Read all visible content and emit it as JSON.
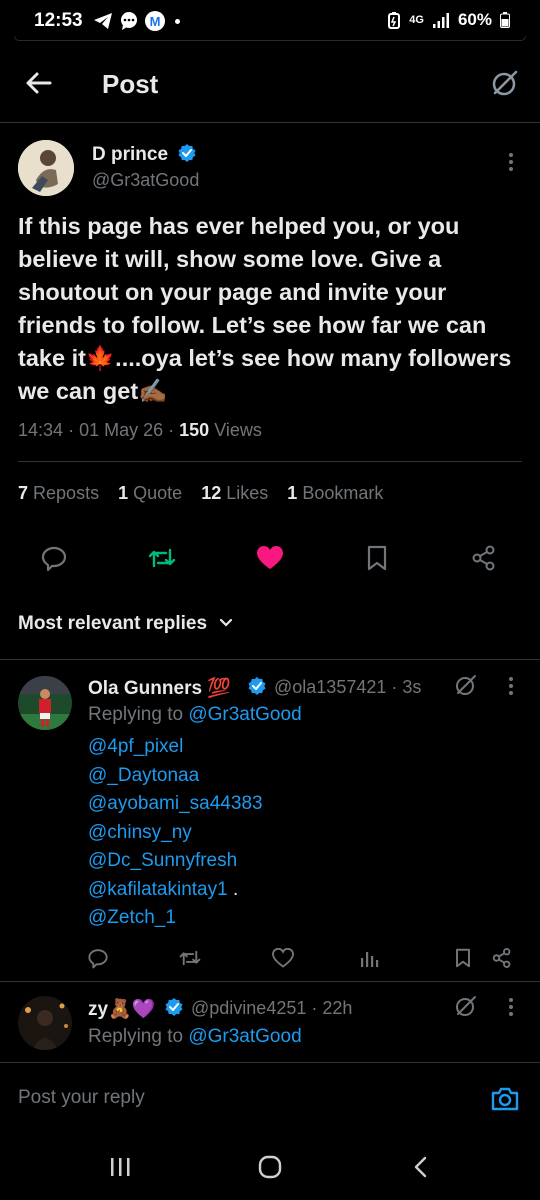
{
  "status_bar": {
    "time": "12:53",
    "left_badge": "M",
    "network": "4G",
    "battery": "60%"
  },
  "header": {
    "title": "Post"
  },
  "post": {
    "author_name": "D prince",
    "author_handle": "@Gr3atGood",
    "text": "If this page has ever helped you, or you believe it will, show some love. Give a shoutout on your page and invite your friends to follow. Let’s see how far we can take it🍁....oya let’s see how many followers we can get✍🏾",
    "time": "14:34",
    "date": "01 May 26",
    "views_count": "150",
    "views_label": "Views",
    "stats": [
      {
        "num": "7",
        "label": "Reposts"
      },
      {
        "num": "1",
        "label": "Quote"
      },
      {
        "num": "12",
        "label": "Likes"
      },
      {
        "num": "1",
        "label": "Bookmark"
      }
    ],
    "colors": {
      "accent": "#1d9bf0",
      "like": "#f91880",
      "repost": "#00ba7c"
    }
  },
  "replies_filter": "Most relevant replies",
  "replies": [
    {
      "name": "Ola Gunners 💯",
      "handle": "@ola1357421",
      "time": "· 3s",
      "replying_prefix": "Replying to ",
      "replying_to": "@Gr3atGood",
      "mentions": [
        "@4pf_pixel",
        "@_Daytonaa",
        "@ayobami_sa44383",
        "@chinsy_ny",
        "@Dc_Sunnyfresh",
        "@kafilatakintay1",
        "@Zetch_1"
      ],
      "mention_suffix": " ."
    },
    {
      "name": "zy🧸💜",
      "handle": "@pdivine4251",
      "time": "· 22h",
      "replying_prefix": "Replying to ",
      "replying_to": "@Gr3atGood"
    }
  ],
  "reply_bar": {
    "placeholder": "Post your reply"
  }
}
